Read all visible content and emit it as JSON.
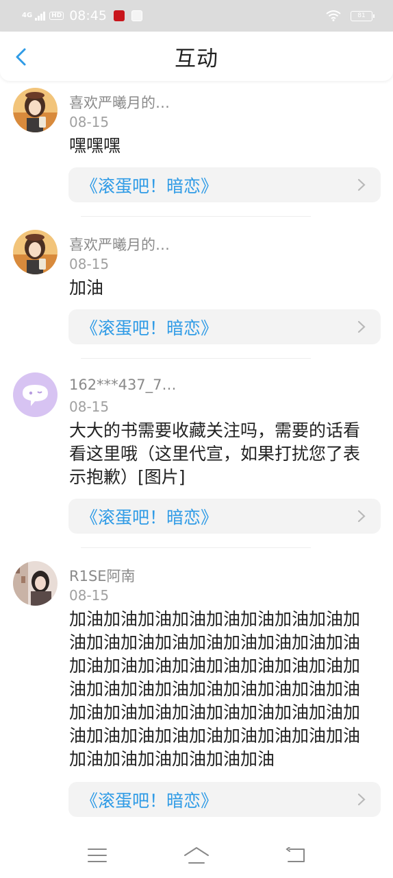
{
  "status_bar": {
    "network": "4G",
    "hd": "HD",
    "time": "08:45",
    "battery": "81"
  },
  "header": {
    "title": "互动"
  },
  "comments": [
    {
      "user": "喜欢严曦月的…",
      "date": "08-15",
      "text": "嘿嘿嘿",
      "book": "《滚蛋吧！暗恋》",
      "avatar": "girl-avatar-icon"
    },
    {
      "user": "喜欢严曦月的…",
      "date": "08-15",
      "text": "加油",
      "book": "《滚蛋吧！暗恋》",
      "avatar": "girl-avatar-icon"
    },
    {
      "user": "162***437_7…",
      "date": "08-15",
      "text": "大大的书需要收藏关注吗，需要的话看看这里哦（这里代宣，如果打扰您了表示抱歉）[图片]",
      "book": "《滚蛋吧！暗恋》",
      "avatar": "chat-bubble-avatar-icon"
    },
    {
      "user": "R1SE阿南",
      "date": "08-15",
      "text": "加油加油加油加油加油加油加油加油加油加油加油加油加油加油加油加油加油加油加油加油加油加油加油加油加油加油加油加油加油加油加油加油加油加油加油加油加油加油加油加油加油加油加油加油加油加油加油加油加油加油加油加油加油加油加油加油加油",
      "book": "《滚蛋吧！暗恋》",
      "avatar": "photo-avatar-icon"
    }
  ],
  "colors": {
    "accent": "#2f9be6",
    "status_bar_bg": "#dcdcdc",
    "link_bg": "#f3f3f3"
  }
}
